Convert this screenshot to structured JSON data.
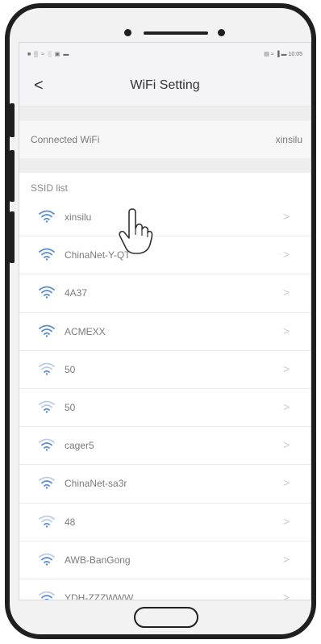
{
  "status_bar": {
    "left_icons": "■ ▒ ≈ ░ ▣ ▬",
    "right_text": "▤ ≈ ▐ ▬ 10:05"
  },
  "header": {
    "back_label": "<",
    "title": "WiFi Setting"
  },
  "connected": {
    "label": "Connected WiFi",
    "value": "xinsilu"
  },
  "ssid_list": {
    "header": "SSID list",
    "items": [
      {
        "name": "xinsilu",
        "chevron": ">",
        "icon": "wifi-icon",
        "strength": "strong"
      },
      {
        "name": "ChinaNet-Y-QT",
        "chevron": ">",
        "icon": "wifi-icon",
        "strength": "strong"
      },
      {
        "name": "4A37",
        "chevron": ">",
        "icon": "wifi-icon",
        "strength": "strong"
      },
      {
        "name": "ACMEXX",
        "chevron": ">",
        "icon": "wifi-icon",
        "strength": "strong"
      },
      {
        "name": "50",
        "chevron": ">",
        "icon": "wifi-icon",
        "strength": "weak"
      },
      {
        "name": "50",
        "chevron": ">",
        "icon": "wifi-icon",
        "strength": "weak"
      },
      {
        "name": "cager5",
        "chevron": ">",
        "icon": "wifi-icon",
        "strength": "medium"
      },
      {
        "name": "ChinaNet-sa3r",
        "chevron": ">",
        "icon": "wifi-icon",
        "strength": "medium"
      },
      {
        "name": "48",
        "chevron": ">",
        "icon": "wifi-icon",
        "strength": "weak"
      },
      {
        "name": "AWB-BanGong",
        "chevron": ">",
        "icon": "wifi-icon",
        "strength": "medium"
      },
      {
        "name": "YDH-ZZZWWW",
        "chevron": ">",
        "icon": "wifi-icon",
        "strength": "medium"
      }
    ]
  },
  "colors": {
    "wifi_icon": "#5b8dd6",
    "text": "#7b7b7b",
    "phone_frame": "#1f1f1f"
  },
  "icons": {
    "pointer": "hand-pointer-icon",
    "back": "chevron-left-icon",
    "row_arrow": "chevron-right-icon"
  }
}
